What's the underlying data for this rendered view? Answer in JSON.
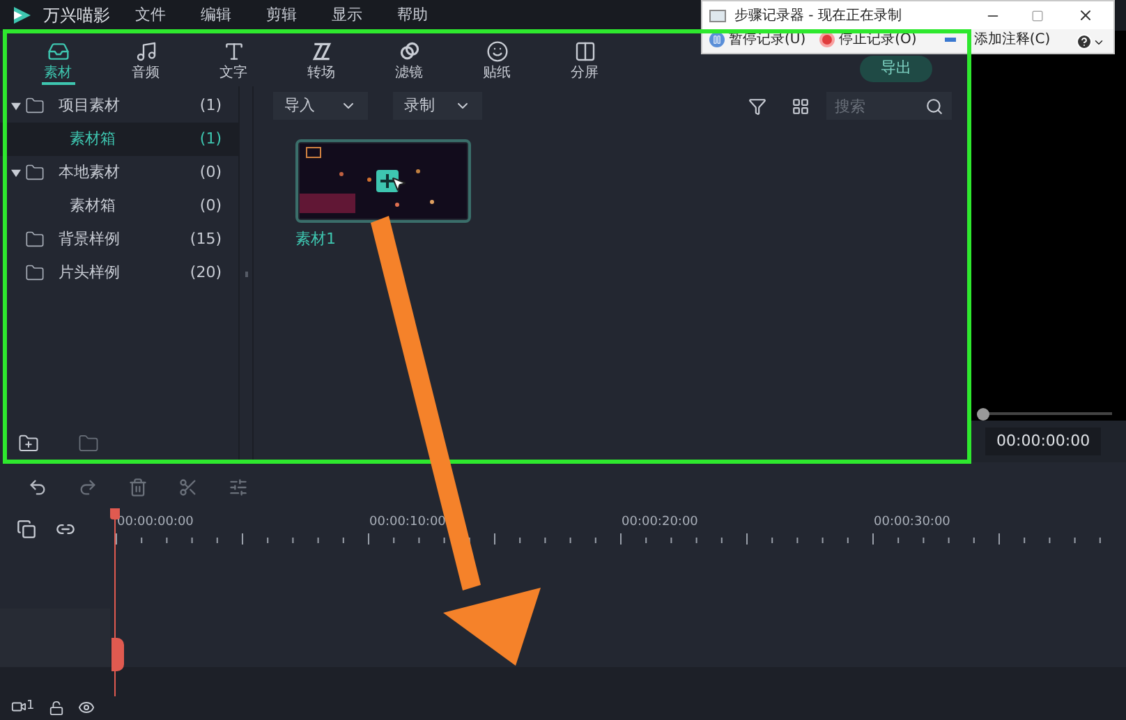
{
  "app": {
    "name": "万兴喵影"
  },
  "menu": [
    "文件",
    "编辑",
    "剪辑",
    "显示",
    "帮助"
  ],
  "tabs": [
    {
      "label": "素材",
      "selected": true
    },
    {
      "label": "音频",
      "selected": false
    },
    {
      "label": "文字",
      "selected": false
    },
    {
      "label": "转场",
      "selected": false
    },
    {
      "label": "滤镜",
      "selected": false
    },
    {
      "label": "贴纸",
      "selected": false
    },
    {
      "label": "分屏",
      "selected": false
    }
  ],
  "export_button": "导出",
  "step_recorder": {
    "title": "步骤记录器 - 现在正在录制",
    "buttons": [
      {
        "kind": "pause",
        "label": "暂停记录(U)"
      },
      {
        "kind": "stop",
        "label": "停止记录(O)"
      },
      {
        "kind": "note",
        "label": "添加注释(C)"
      }
    ]
  },
  "tree": [
    {
      "label": "项目素材",
      "count": "(1)",
      "selected": false,
      "expanded": true,
      "children": [
        {
          "label": "素材箱",
          "count": "(1)",
          "selected": true
        }
      ]
    },
    {
      "label": "本地素材",
      "count": "(0)",
      "selected": false,
      "expanded": true,
      "children": [
        {
          "label": "素材箱",
          "count": "(0)",
          "selected": false
        }
      ]
    },
    {
      "label": "背景样例",
      "count": "(15)",
      "selected": false
    },
    {
      "label": "片头样例",
      "count": "(20)",
      "selected": false
    }
  ],
  "media_toolbar": {
    "import": "导入",
    "record": "录制",
    "search_placeholder": "搜索"
  },
  "media": [
    {
      "label": "素材1",
      "selected": true
    }
  ],
  "preview": {
    "level": 0,
    "timecode": "00:00:00:00"
  },
  "timeline": {
    "ruler": [
      "00:00:00:00",
      "00:00:10:00",
      "00:00:20:00",
      "00:00:30:00"
    ],
    "track_number": "1"
  }
}
